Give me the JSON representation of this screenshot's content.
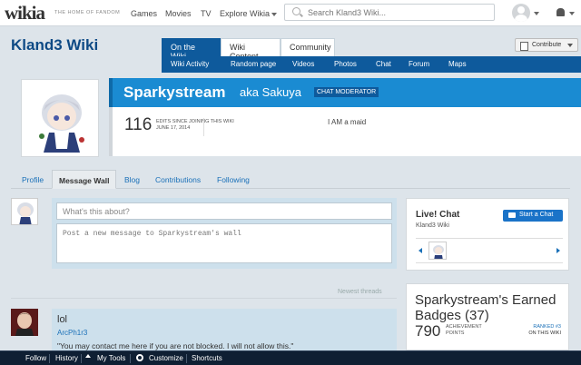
{
  "global_nav": {
    "logo": "wikia",
    "tagline": "THE HOME OF FANDOM",
    "links": [
      "Games",
      "Movies",
      "TV",
      "Explore Wikia"
    ],
    "search_placeholder": "Search Kland3 Wiki..."
  },
  "wiki": {
    "name": "Kland3 Wiki",
    "tabs": [
      "On the Wiki",
      "Wiki Content",
      "Community"
    ],
    "subnav": [
      "Wiki Activity",
      "Random page",
      "Videos",
      "Photos",
      "Chat",
      "Forum",
      "Maps"
    ],
    "contribute_label": "Contribute"
  },
  "profile": {
    "username": "Sparkystream",
    "aka": "aka Sakuya",
    "badge": "CHAT MODERATOR",
    "edit_count": "116",
    "edit_label": "EDITS SINCE JOINING THIS WIKI",
    "join_date": "JUNE 17, 2014",
    "bio": "I AM a maid",
    "tabs": [
      "Profile",
      "Message Wall",
      "Blog",
      "Contributions",
      "Following"
    ]
  },
  "wall": {
    "title_placeholder": "What's this about?",
    "body_placeholder": "Post a new message to Sparkystream's wall",
    "sort_label": "Newest threads",
    "thread": {
      "title": "lol",
      "author": "ArcPh1r3",
      "body": "\"You may contact me here if you are not blocked. I will not allow this.\""
    }
  },
  "rail": {
    "chat_title": "Live! Chat",
    "chat_wiki": "Kland3 Wiki",
    "chat_button": "Start a Chat",
    "badges_title": "Sparkystream's Earned Badges (37)",
    "badge_points": "790",
    "points_label_1": "ACHIEVEMENT",
    "points_label_2": "POINTS",
    "rank_label": "RANKED #3",
    "rank_scope": "ON THIS WIKI"
  },
  "toolbar": {
    "items": [
      "Follow",
      "History",
      "My Tools",
      "Customize",
      "Shortcuts"
    ]
  },
  "colors": {
    "brand_blue": "#0e5a9c",
    "masthead_blue": "#1a8bd2",
    "link_blue": "#1a70b8",
    "toolbar_bg": "#0f1f33"
  }
}
